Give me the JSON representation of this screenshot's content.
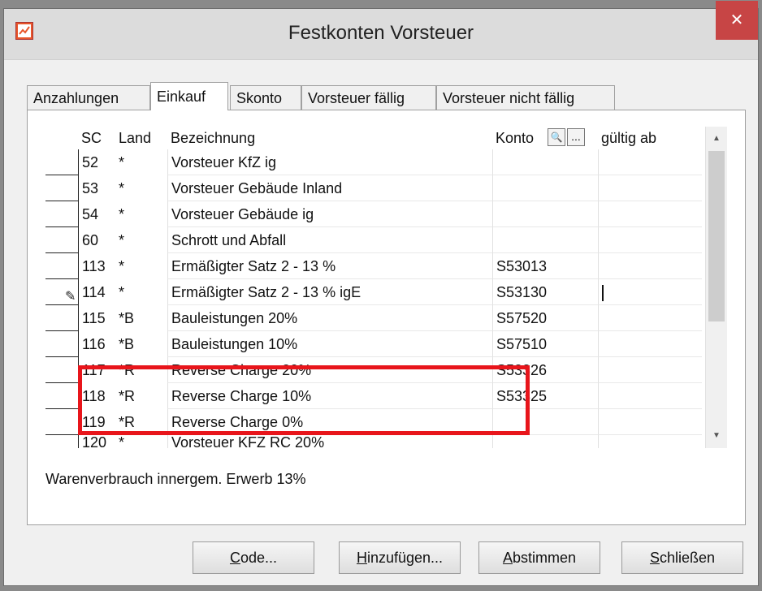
{
  "window": {
    "title": "Festkonten Vorsteuer",
    "close_glyph": "✕"
  },
  "tabs": [
    {
      "label": "Anzahlungen",
      "active": false
    },
    {
      "label": "Einkauf",
      "active": true
    },
    {
      "label": "Skonto",
      "active": false
    },
    {
      "label": "Vorsteuer fällig",
      "active": false
    },
    {
      "label": "Vorsteuer nicht fällig",
      "active": false
    }
  ],
  "grid": {
    "columns": {
      "sc": "SC",
      "land": "Land",
      "bez": "Bezeichnung",
      "konto": "Konto",
      "gueltig": "gültig ab"
    },
    "search_btn": "🔍",
    "more_btn": "...",
    "rows": [
      {
        "sc": "52",
        "land": "*",
        "bez": "Vorsteuer KfZ ig",
        "konto": "",
        "gueltig": ""
      },
      {
        "sc": "53",
        "land": "*",
        "bez": "Vorsteuer Gebäude Inland",
        "konto": "",
        "gueltig": ""
      },
      {
        "sc": "54",
        "land": "*",
        "bez": "Vorsteuer Gebäude ig",
        "konto": "",
        "gueltig": ""
      },
      {
        "sc": "60",
        "land": "*",
        "bez": "Schrott und Abfall",
        "konto": "",
        "gueltig": ""
      },
      {
        "sc": "113",
        "land": "*",
        "bez": "Ermäßigter Satz 2 - 13 %",
        "konto": "S53013",
        "gueltig": ""
      },
      {
        "sc": "114",
        "land": "*",
        "bez": "Ermäßigter Satz 2 - 13 % igE",
        "konto": "S53130",
        "gueltig": ""
      },
      {
        "sc": "115",
        "land": "*B",
        "bez": "Bauleistungen 20%",
        "konto": "S57520",
        "gueltig": ""
      },
      {
        "sc": "116",
        "land": "*B",
        "bez": "Bauleistungen 10%",
        "konto": "S57510",
        "gueltig": ""
      },
      {
        "sc": "117",
        "land": "*R",
        "bez": "Reverse Charge 20%",
        "konto": "S53326",
        "gueltig": ""
      },
      {
        "sc": "118",
        "land": "*R",
        "bez": "Reverse Charge 10%",
        "konto": "S53325",
        "gueltig": ""
      },
      {
        "sc": "119",
        "land": "*R",
        "bez": "Reverse Charge 0%",
        "konto": "",
        "gueltig": ""
      },
      {
        "sc": "120",
        "land": "*",
        "bez": "Vorsteuer KFZ RC 20%",
        "konto": "",
        "gueltig": ""
      }
    ]
  },
  "status_text": "Warenverbrauch innergem. Erwerb 13%",
  "buttons": {
    "code": {
      "accel": "C",
      "rest": "ode..."
    },
    "add": {
      "accel": "H",
      "rest": "inzufügen..."
    },
    "match": {
      "accel": "A",
      "rest": "bstimmen"
    },
    "close": {
      "accel": "S",
      "rest": "chließen"
    }
  },
  "colors": {
    "highlight": "#e8151b",
    "close_button": "#c74545"
  },
  "icons": {
    "app": "app-icon",
    "edit_row": "pencil-icon"
  }
}
